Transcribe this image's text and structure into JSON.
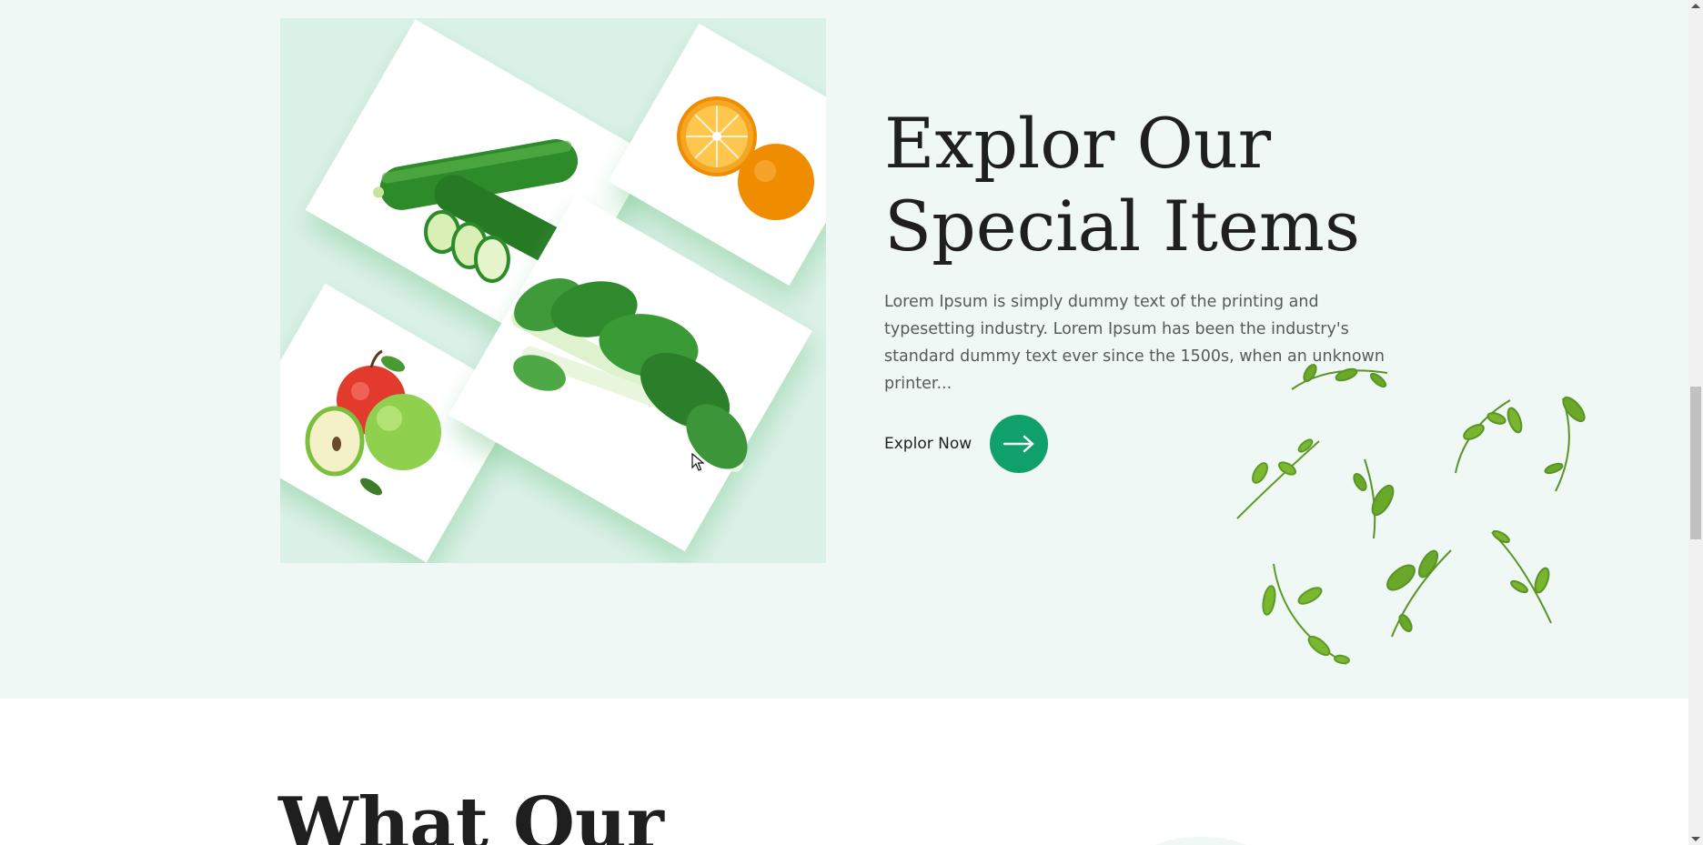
{
  "special": {
    "title_line1": "Explor Our",
    "title_line2": "Special Items",
    "description": "Lorem Ipsum is simply dummy text of the printing and typesetting industry. Lorem Ipsum has been the industry's standard dummy text ever since the 1500s, when an unknown printer...",
    "cta_label": "Explor Now",
    "cta_icon": "arrow-right-icon",
    "accent_color": "#10a06b",
    "products": [
      "cucumber-image",
      "orange-image",
      "apple-image",
      "bok-choy-image"
    ]
  },
  "testimonials": {
    "title": "What Our"
  }
}
